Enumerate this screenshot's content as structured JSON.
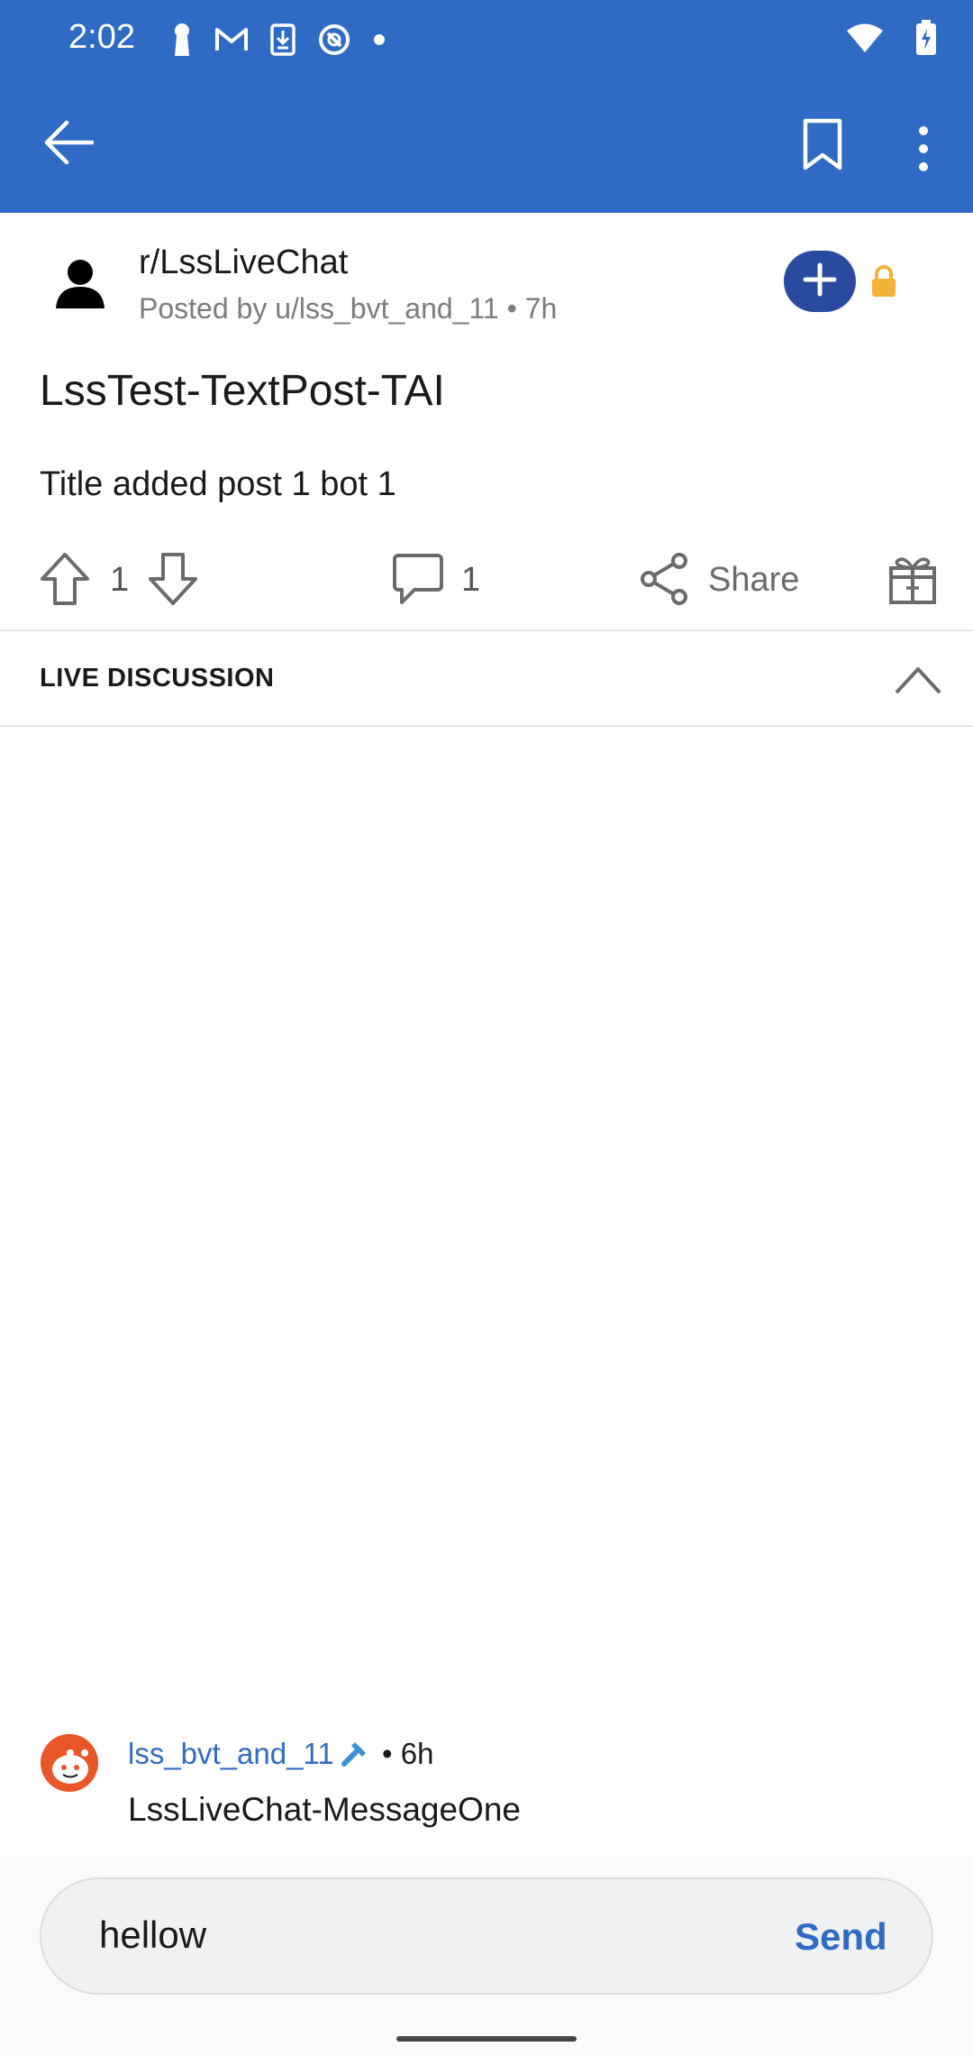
{
  "status_bar": {
    "time": "2:02",
    "icons_left": [
      "keyhole-icon",
      "gmail-icon",
      "download-icon",
      "vpn-icon",
      "dot-icon"
    ],
    "icons_right": [
      "wifi-icon",
      "battery-charging-icon"
    ]
  },
  "app_bar": {
    "back_icon": "arrow-left-icon",
    "bookmark_icon": "bookmark-icon",
    "more_icon": "more-vertical-icon",
    "background_color": "#2f6bc4"
  },
  "post": {
    "subreddit": "r/LssLiveChat",
    "posted_by": "Posted by u/lss_bvt_and_11 • 7h",
    "title": "LssTest-TextPost-TAI",
    "body": "Title added post 1 bot 1",
    "vote_count": "1",
    "comment_count": "1",
    "share_label": "Share"
  },
  "live_discussion": {
    "title": "LIVE DISCUSSION"
  },
  "messages": [
    {
      "username": "lss_bvt_and_11",
      "time": "• 6h",
      "text": "LssLiveChat-MessageOne"
    }
  ],
  "composer": {
    "value": "hellow",
    "send_label": "Send"
  },
  "colors": {
    "accent": "#2f6bc4",
    "join_button": "#2a4aa0",
    "lock": "#f5b335",
    "avatar_orange": "#e8562a"
  }
}
